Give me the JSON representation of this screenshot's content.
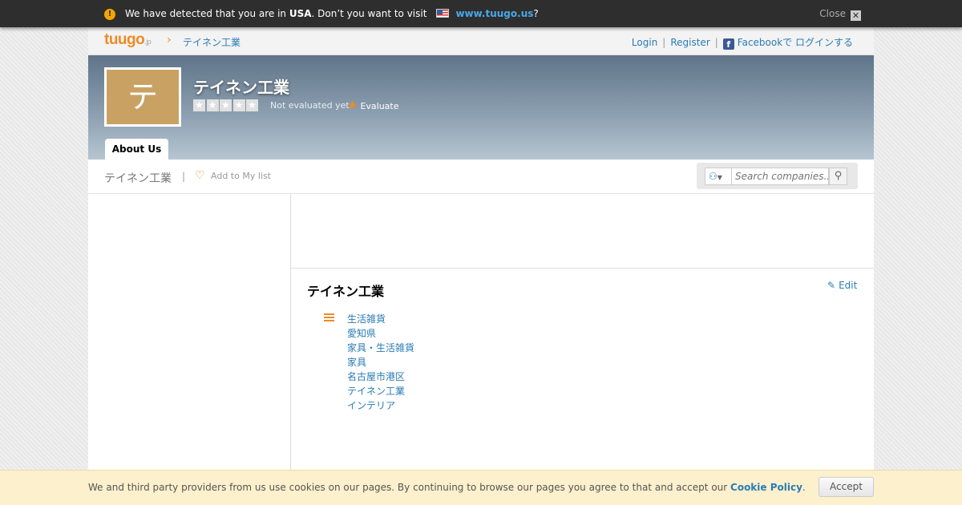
{
  "geo_bar": {
    "text_before": "We have detected that you are in ",
    "country": "USA",
    "text_after": ". Don’t you want to visit",
    "link": "www.tuugo.us",
    "question_mark": "?",
    "close_label": "Close",
    "warn_symbol": "!"
  },
  "nav": {
    "logo_text": "tuugo",
    "logo_suffix": ".jp",
    "breadcrumb_sep": "›",
    "breadcrumb": "テイネン工業",
    "login": "Login",
    "register": "Register",
    "separator": "|",
    "facebook_login": "Facebookで ログインする"
  },
  "header": {
    "avatar_letter": "テ",
    "company_name": "テイネン工業",
    "rating_status": "Not evaluated yet",
    "evaluate_label": "Evaluate",
    "stars_filled": 0,
    "stars_total": 5
  },
  "tabs": [
    {
      "label": "About Us",
      "active": true
    }
  ],
  "subbar": {
    "company_name": "テイネン工業",
    "separator": "|",
    "add_to_list": "Add to My list",
    "search_placeholder": "Search companies..."
  },
  "content": {
    "section_title": "テイネン工業",
    "edit_label": "Edit",
    "categories": [
      "生活雑貨",
      "愛知県",
      "家具・生活雑貨",
      "家具",
      "名古屋市港区",
      "テイネン工業",
      "インテリア"
    ]
  },
  "cookie": {
    "text": "We and third party providers from us use cookies on our pages. By continuing to browse our pages you agree to that and accept our ",
    "policy_link": "Cookie Policy",
    "period": ".",
    "accept_label": "Accept"
  },
  "colors": {
    "accent": "#f08a24",
    "link": "#2a7bb5",
    "geo_link": "#4aa8e8",
    "avatar_bg": "#c9a263"
  }
}
